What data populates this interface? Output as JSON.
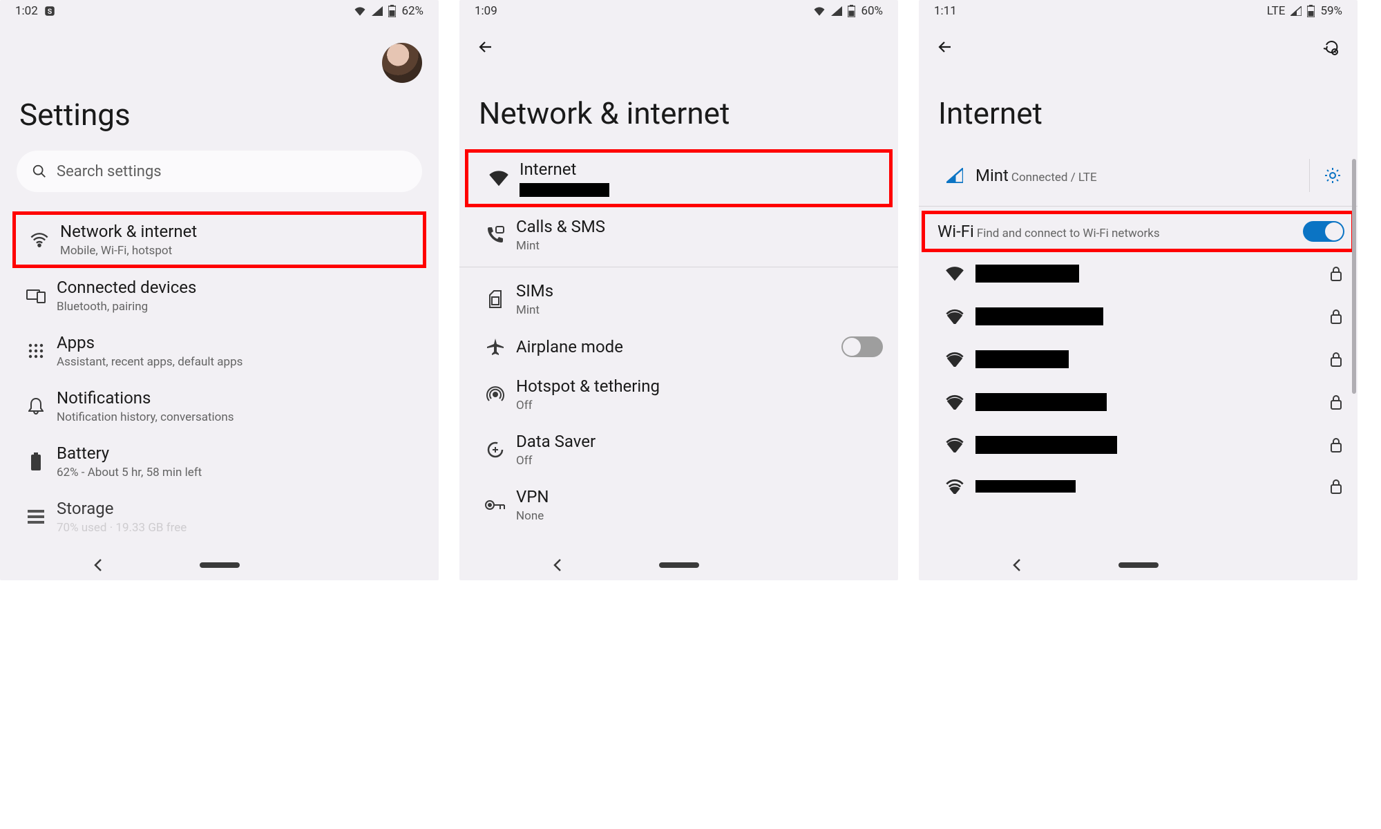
{
  "p1": {
    "status": {
      "time": "1:02",
      "battery": "62%"
    },
    "title": "Settings",
    "search_placeholder": "Search settings",
    "items": [
      {
        "title": "Network & internet",
        "sub": "Mobile, Wi-Fi, hotspot",
        "icon": "wifi-icon"
      },
      {
        "title": "Connected devices",
        "sub": "Bluetooth, pairing",
        "icon": "devices-icon"
      },
      {
        "title": "Apps",
        "sub": "Assistant, recent apps, default apps",
        "icon": "apps-grid-icon"
      },
      {
        "title": "Notifications",
        "sub": "Notification history, conversations",
        "icon": "bell-icon"
      },
      {
        "title": "Battery",
        "sub": "62% - About 5 hr, 58 min left",
        "icon": "battery-icon"
      },
      {
        "title": "Storage",
        "sub": "70% used · 19.33 GB free",
        "icon": "storage-icon"
      }
    ]
  },
  "p2": {
    "status": {
      "time": "1:09",
      "battery": "60%"
    },
    "title": "Network & internet",
    "items": [
      {
        "title": "Internet",
        "sub_redacted": true,
        "icon": "wifi-fill-icon"
      },
      {
        "title": "Calls & SMS",
        "sub": "Mint",
        "icon": "phone-sms-icon"
      },
      {
        "title": "SIMs",
        "sub": "Mint",
        "icon": "sim-icon"
      },
      {
        "title": "Airplane mode",
        "icon": "airplane-icon",
        "toggle": "off"
      },
      {
        "title": "Hotspot & tethering",
        "sub": "Off",
        "icon": "hotspot-icon"
      },
      {
        "title": "Data Saver",
        "sub": "Off",
        "icon": "datasaver-icon"
      },
      {
        "title": "VPN",
        "sub": "None",
        "icon": "vpn-key-icon"
      }
    ]
  },
  "p3": {
    "status": {
      "time": "1:11",
      "battery": "59%",
      "net": "LTE"
    },
    "title": "Internet",
    "carrier": {
      "name": "Mint",
      "status": "Connected / LTE"
    },
    "wifi": {
      "title": "Wi-Fi",
      "sub": "Find and connect to Wi-Fi networks",
      "toggle": "on"
    },
    "networks_redacted_count": 6
  }
}
